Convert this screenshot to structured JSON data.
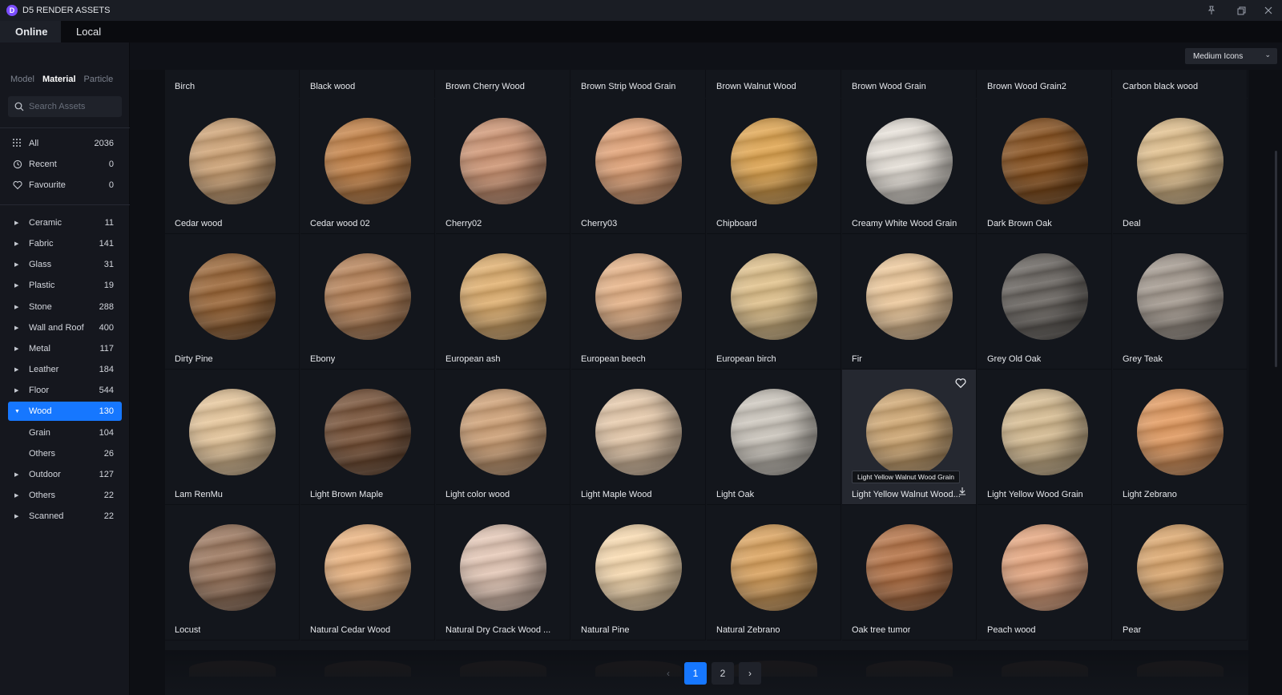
{
  "window": {
    "title": "D5 RENDER ASSETS",
    "logo": "D"
  },
  "tabs": {
    "online": "Online",
    "local": "Local"
  },
  "type_tabs": [
    "Model",
    "Material",
    "Particle"
  ],
  "search": {
    "placeholder": "Search Assets"
  },
  "view_select": {
    "value": "Medium Icons"
  },
  "quick": [
    {
      "label": "All",
      "count": "2036",
      "icon": "grid-icon"
    },
    {
      "label": "Recent",
      "count": "0",
      "icon": "history-icon"
    },
    {
      "label": "Favourite",
      "count": "0",
      "icon": "heart-icon"
    }
  ],
  "categories": [
    {
      "label": "Ceramic",
      "count": "11"
    },
    {
      "label": "Fabric",
      "count": "141"
    },
    {
      "label": "Glass",
      "count": "31"
    },
    {
      "label": "Plastic",
      "count": "19"
    },
    {
      "label": "Stone",
      "count": "288"
    },
    {
      "label": "Wall and Roof",
      "count": "400"
    },
    {
      "label": "Metal",
      "count": "117"
    },
    {
      "label": "Leather",
      "count": "184"
    },
    {
      "label": "Floor",
      "count": "544"
    },
    {
      "label": "Wood",
      "count": "130",
      "active": true
    },
    {
      "label": "Grain",
      "count": "104",
      "sub": true
    },
    {
      "label": "Others",
      "count": "26",
      "sub": true
    },
    {
      "label": "Outdoor",
      "count": "127"
    },
    {
      "label": "Others",
      "count": "22"
    },
    {
      "label": "Scanned",
      "count": "22"
    }
  ],
  "top_labels": [
    "Birch",
    "Black wood",
    "Brown Cherry Wood",
    "Brown Strip Wood Grain",
    "Brown Walnut Wood",
    "Brown Wood Grain",
    "Brown Wood Grain2",
    "Carbon black wood"
  ],
  "materials": [
    {
      "name": "Cedar wood",
      "color": "#c8a27a"
    },
    {
      "name": "Cedar wood 02",
      "color": "#c08652"
    },
    {
      "name": "Cherry02",
      "color": "#c9977a"
    },
    {
      "name": "Cherry03",
      "color": "#d9a27c"
    },
    {
      "name": "Chipboard",
      "color": "#d7a45a"
    },
    {
      "name": "Creamy White Wood Grain",
      "color": "#ddd8d1"
    },
    {
      "name": "Dark Brown Oak",
      "color": "#8a5a2e"
    },
    {
      "name": "Deal",
      "color": "#d8bb8f"
    },
    {
      "name": "Dirty Pine",
      "color": "#9a6c43"
    },
    {
      "name": "Ebony",
      "color": "#b48661"
    },
    {
      "name": "European ash",
      "color": "#d7ad75"
    },
    {
      "name": "European beech",
      "color": "#ddb08a"
    },
    {
      "name": "European birch",
      "color": "#d7bc8d"
    },
    {
      "name": "Fir",
      "color": "#e3c39b"
    },
    {
      "name": "Grey Old Oak",
      "color": "#6f6b67"
    },
    {
      "name": "Grey Teak",
      "color": "#a39a91"
    },
    {
      "name": "Lam RenMu",
      "color": "#dcc09a"
    },
    {
      "name": "Light Brown Maple",
      "color": "#7b5a43"
    },
    {
      "name": "Light color wood",
      "color": "#c8a07b"
    },
    {
      "name": "Light Maple Wood",
      "color": "#dcc3a8"
    },
    {
      "name": "Light Oak",
      "color": "#c6c1b9"
    },
    {
      "name": "Light Yellow Walnut Wood...",
      "color": "#c9a678",
      "hover": true,
      "tooltip": "Light Yellow Walnut Wood Grain"
    },
    {
      "name": "Light Yellow Wood Grain",
      "color": "#cfb893"
    },
    {
      "name": "Light Zebrano",
      "color": "#d99a67"
    },
    {
      "name": "Locust",
      "color": "#9b7b65"
    },
    {
      "name": "Natural Cedar Wood",
      "color": "#e0b083"
    },
    {
      "name": "Natural Dry Crack Wood ...",
      "color": "#dbc2b3"
    },
    {
      "name": "Natural Pine",
      "color": "#ecd2ad"
    },
    {
      "name": "Natural Zebrano",
      "color": "#d3a266"
    },
    {
      "name": "Oak tree tumor",
      "color": "#b17750"
    },
    {
      "name": "Peach wood",
      "color": "#dca583"
    },
    {
      "name": "Pear",
      "color": "#d4a674"
    }
  ],
  "pagination": {
    "pages": [
      "1",
      "2"
    ],
    "current": "1",
    "prev": "‹",
    "next": "›"
  }
}
